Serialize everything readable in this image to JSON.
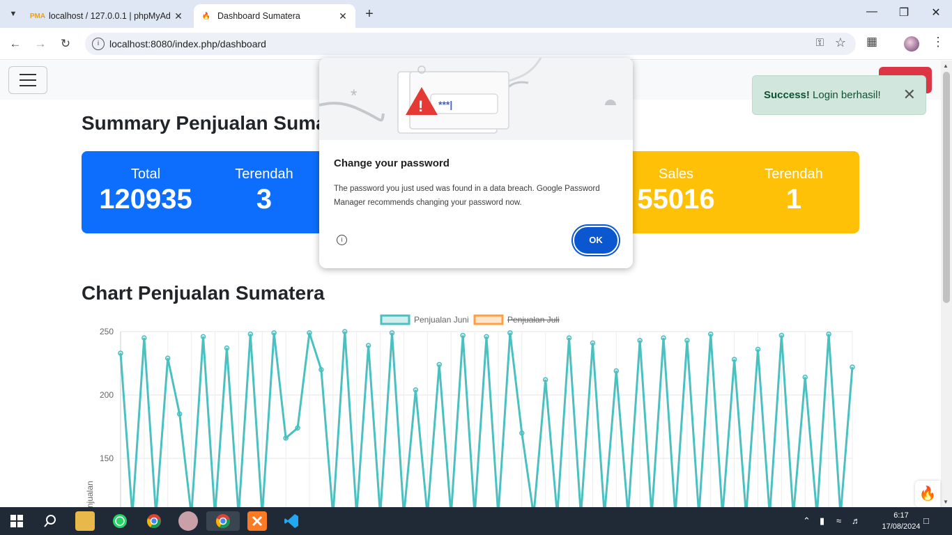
{
  "browser": {
    "tabs": [
      {
        "title": "localhost / 127.0.0.1 | phpMyAd",
        "favicon": "pma-icon",
        "active": false
      },
      {
        "title": "Dashboard Sumatera",
        "favicon": "flame-icon",
        "active": true
      }
    ],
    "url": "localhost:8080/index.php/dashboard"
  },
  "page": {
    "summary_title": "Summary Penjualan Sumat",
    "cards": {
      "blue": [
        {
          "label": "Total",
          "value": "120935"
        },
        {
          "label": "Terendah",
          "value": "3"
        }
      ],
      "yellow": [
        {
          "label": "Sales",
          "value": "55016"
        },
        {
          "label": "Terendah",
          "value": "1"
        }
      ]
    },
    "chart_title": "Chart Penjualan Sumatera"
  },
  "dialog": {
    "title": "Change your password",
    "text": "The password you just used was found in a data breach. Google Password Manager recommends changing your password now.",
    "ok_label": "OK",
    "password_mask": "***|"
  },
  "toast": {
    "strong": "Success!",
    "message": "Login berhasil!"
  },
  "taskbar": {
    "time": "6:17",
    "date": "17/08/2024"
  },
  "colors": {
    "series_juni": "#4bc0c0",
    "series_juli": "#ff9f40",
    "card_blue": "#0d6efd",
    "card_yellow": "#ffc107"
  },
  "chart_data": {
    "type": "line",
    "ylabel": "Penjualan",
    "yticks": [
      "250",
      "200",
      "150"
    ],
    "ylim": [
      100,
      250
    ],
    "legend_position": "top",
    "series": [
      {
        "name": "Penjualan Juni",
        "hidden": false,
        "values": [
          233,
          105,
          245,
          105,
          229,
          185,
          105,
          246,
          105,
          237,
          105,
          248,
          105,
          249,
          166,
          174,
          249,
          220,
          105,
          250,
          105,
          239,
          105,
          249,
          105,
          204,
          105,
          224,
          105,
          247,
          105,
          246,
          105,
          249,
          170,
          105,
          212,
          105,
          245,
          105,
          241,
          105,
          219,
          105,
          243,
          105,
          245,
          105,
          243,
          105,
          248,
          105,
          228,
          105,
          236,
          105,
          247,
          105,
          214,
          105,
          248,
          105,
          222
        ]
      },
      {
        "name": "Penjualan Juli",
        "hidden": true,
        "values": []
      }
    ]
  }
}
